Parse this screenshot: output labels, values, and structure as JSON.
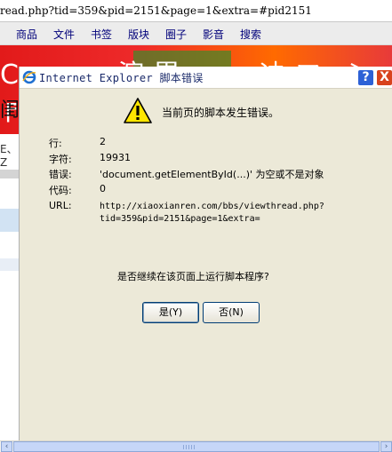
{
  "browser": {
    "address_fragment": "read.php?tid=359&pid=2151&page=1&extra=#pid2151",
    "nav_items": [
      "商品",
      "文件",
      "书签",
      "版块",
      "圈子",
      "影音",
      "搜索"
    ],
    "banner_fragment_top": "Cr 。 演累 ，  迪ヱ ＞ ╒",
    "banner_fragment_left": "闺",
    "left_fragment": "E、Z"
  },
  "dialog": {
    "title": "Internet Explorer 脚本错误",
    "help_label": "?",
    "close_label": "X",
    "heading": "当前页的脚本发生错误。",
    "fields": [
      {
        "label": "行:",
        "value": "2"
      },
      {
        "label": "字符:",
        "value": "19931"
      },
      {
        "label": "错误:",
        "value": "'document.getElementById(...)' 为空或不是对象"
      },
      {
        "label": "代码:",
        "value": "0"
      },
      {
        "label": "URL:",
        "value": "http://xiaoxianren.com/bbs/viewthread.php?",
        "value2": "tid=359&pid=2151&page=1&extra="
      }
    ],
    "question": "是否继续在该页面上运行脚本程序?",
    "yes_label": "是(Y)",
    "no_label": "否(N)"
  },
  "scrollbar": {
    "left_arrow": "‹",
    "right_arrow": "›"
  }
}
